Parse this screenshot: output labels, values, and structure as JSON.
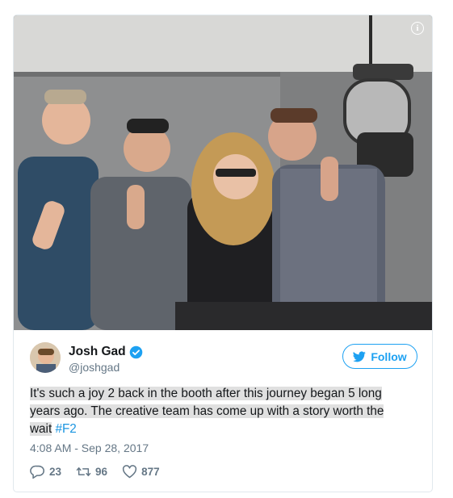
{
  "tweet": {
    "author_name": "Josh Gad",
    "author_handle": "@joshgad",
    "follow_label": "Follow",
    "text_line1": "It's such a joy 2 back in the booth after this journey began 5 long",
    "text_line2": "years ago. The creative team has come up with a story worth the",
    "text_line3": "wait",
    "hashtag": "#F2",
    "timestamp": "4:08 AM - Sep 28, 2017",
    "replies": "23",
    "retweets": "96",
    "likes": "877"
  },
  "icons": {
    "info": "info-icon",
    "verified": "verified-badge-icon",
    "bird": "twitter-bird-icon",
    "reply": "reply-icon",
    "retweet": "retweet-icon",
    "like": "heart-icon"
  },
  "colors": {
    "accent": "#1da1f2",
    "hashtag": "#1b95e0",
    "muted": "#657786",
    "text": "#14171a",
    "border": "#e1e8ed"
  }
}
